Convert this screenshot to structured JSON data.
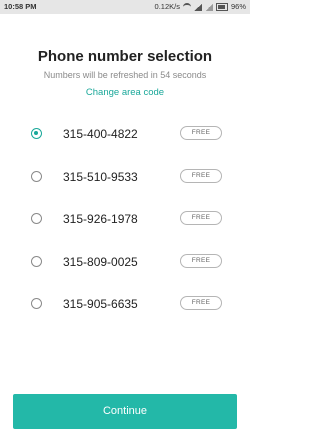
{
  "status_bar": {
    "time": "10:58 PM",
    "speed": "0.12K/s",
    "battery": "96%"
  },
  "header": {
    "title": "Phone number selection",
    "subtitle": "Numbers will be refreshed in 54 seconds",
    "change_link": "Change area code"
  },
  "numbers": [
    {
      "number": "315-400-4822",
      "badge": "FREE",
      "selected": true
    },
    {
      "number": "315-510-9533",
      "badge": "FREE",
      "selected": false
    },
    {
      "number": "315-926-1978",
      "badge": "FREE",
      "selected": false
    },
    {
      "number": "315-809-0025",
      "badge": "FREE",
      "selected": false
    },
    {
      "number": "315-905-6635",
      "badge": "FREE",
      "selected": false
    }
  ],
  "footer": {
    "continue_label": "Continue"
  },
  "colors": {
    "accent": "#1aa89a",
    "button": "#23b8a8"
  }
}
